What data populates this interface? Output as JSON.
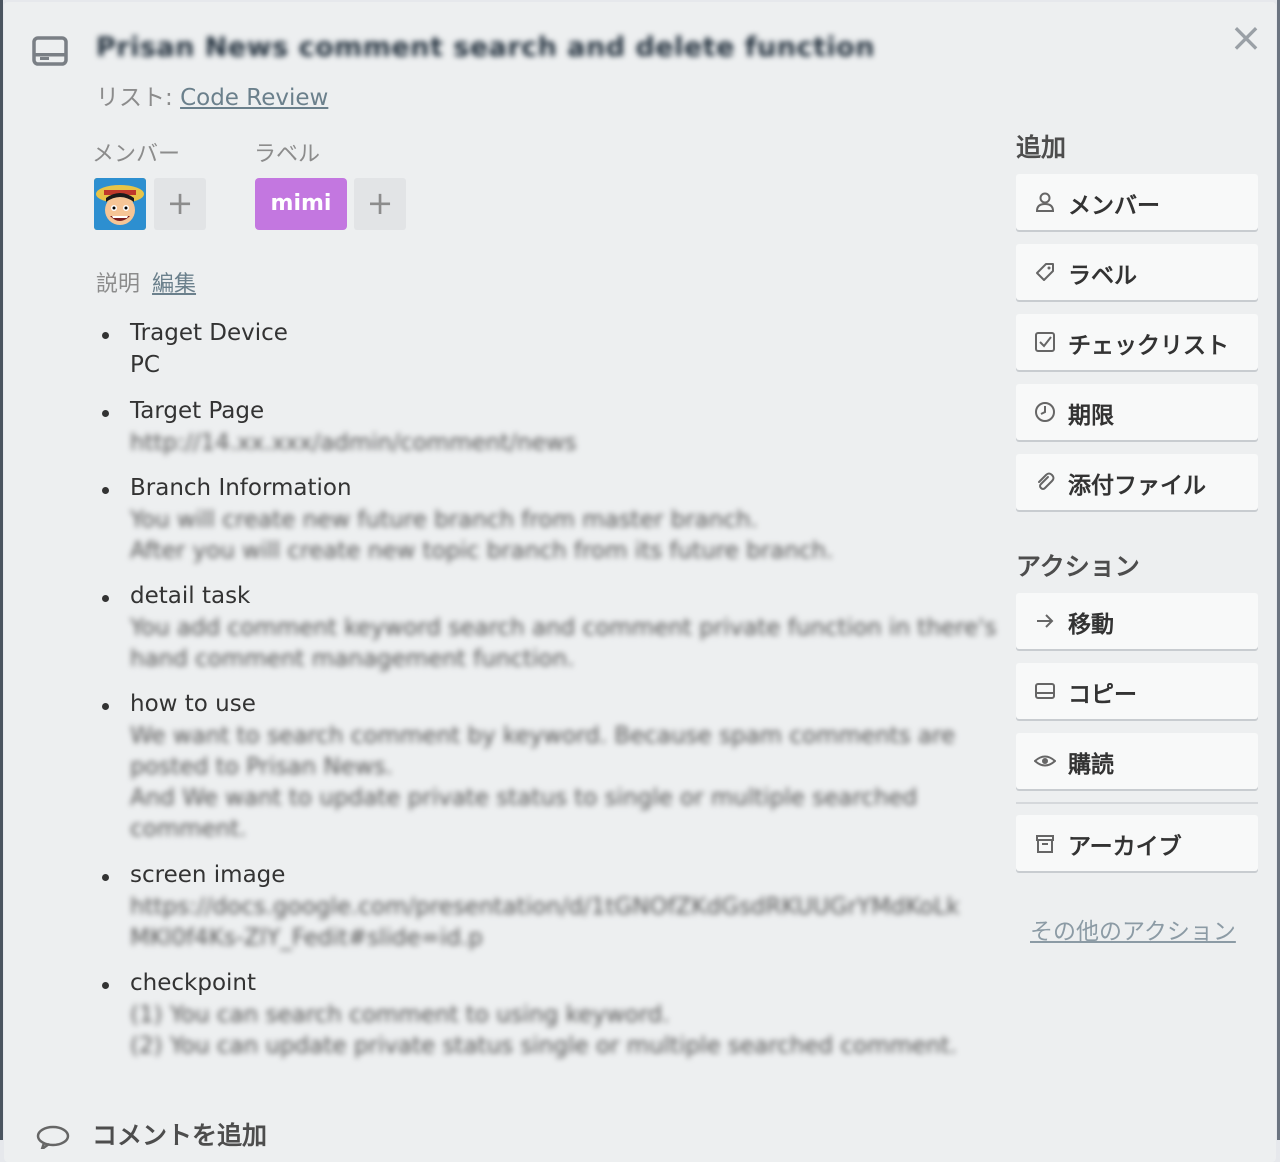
{
  "card": {
    "title": "Prisan News comment search and delete function",
    "list_prefix": "リスト: ",
    "list_name": "Code Review",
    "close": "×"
  },
  "members": {
    "label": "メンバー",
    "add": "+"
  },
  "labels": {
    "label": "ラベル",
    "chip": "mimi",
    "chip_color": "#c377e0",
    "add": "+"
  },
  "description": {
    "label": "説明",
    "edit": "編集",
    "items": [
      {
        "title": "Traget Device",
        "lines": [
          "PC"
        ],
        "blurred": false
      },
      {
        "title": "Target Page",
        "lines": [
          "http://14.xx.xxx/admin/comment/news"
        ],
        "blurred": true
      },
      {
        "title": "Branch Information",
        "lines": [
          "You will create new future branch from master branch.",
          "After you will create new topic branch from its future branch."
        ],
        "blurred": true
      },
      {
        "title": "detail task",
        "lines": [
          "You add comment keyword search and comment private function in there's",
          "hand comment management function."
        ],
        "blurred": true
      },
      {
        "title": "how to use",
        "lines": [
          "We want to search comment by keyword. Because spam comments are",
          "posted to Prisan News.",
          "And We want to update private status to single or multiple searched",
          "comment."
        ],
        "blurred": true
      },
      {
        "title": "screen image",
        "lines": [
          "https://docs.google.com/presentation/d/1tGNOfZKdGsdRKUUGrYMdKoLk",
          "MKl0f4Ks-ZlY_Fedit#slide=id.p"
        ],
        "blurred": true
      },
      {
        "title": "checkpoint",
        "lines": [
          "(1) You can search comment to using keyword.",
          "(2) You can update private status single or multiple searched comment."
        ],
        "blurred": true
      }
    ]
  },
  "sidebar": {
    "add_heading": "追加",
    "add_buttons": [
      {
        "label": "メンバー",
        "icon": "person-icon"
      },
      {
        "label": "ラベル",
        "icon": "tag-icon"
      },
      {
        "label": "チェックリスト",
        "icon": "checkbox-icon"
      },
      {
        "label": "期限",
        "icon": "clock-icon"
      },
      {
        "label": "添付ファイル",
        "icon": "paperclip-icon"
      }
    ],
    "actions_heading": "アクション",
    "action_buttons": [
      {
        "label": "移動",
        "icon": "arrow-right-icon"
      },
      {
        "label": "コピー",
        "icon": "card-icon"
      },
      {
        "label": "購読",
        "icon": "eye-icon"
      }
    ],
    "archive": {
      "label": "アーカイブ",
      "icon": "archive-icon"
    },
    "more_actions": "その他のアクション"
  },
  "comment": {
    "heading": "コメントを追加",
    "icon": "speech-bubble-icon"
  }
}
